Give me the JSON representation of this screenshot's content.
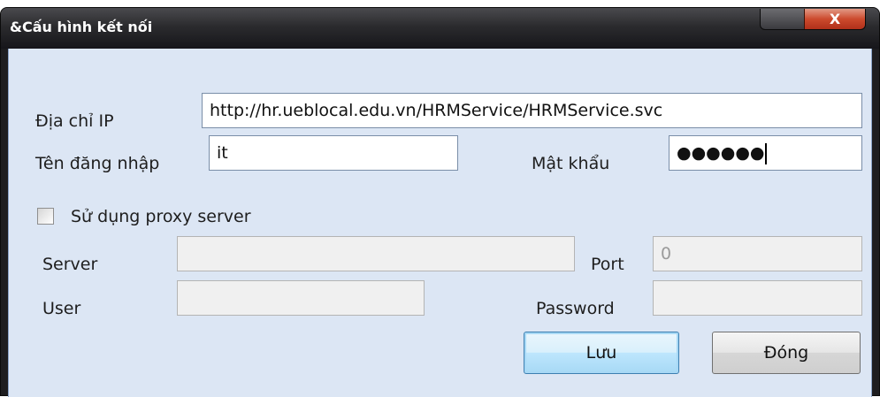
{
  "window": {
    "title": "&Cấu hình kết nối",
    "close_glyph": "X"
  },
  "connection": {
    "ip_label": "Địa chỉ IP",
    "ip_value": "http://hr.ueblocal.edu.vn/HRMService/HRMService.svc",
    "username_label": "Tên đăng nhập",
    "username_value": "it",
    "password_label": "Mật khẩu",
    "password_value": "●●●●●●"
  },
  "proxy": {
    "checkbox_label": "Sử dụng proxy server",
    "checked": false,
    "server_label": "Server",
    "server_value": "",
    "port_label": "Port",
    "port_value": "0",
    "user_label": "User",
    "user_value": "",
    "password_label": "Password",
    "password_value": ""
  },
  "actions": {
    "save_label": "Lưu",
    "close_label": "Đóng"
  }
}
